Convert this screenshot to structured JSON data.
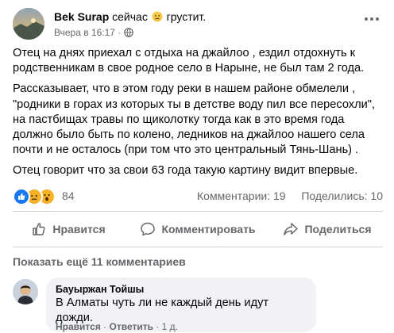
{
  "post": {
    "author": "Bek Surap",
    "activity_prefix": "сейчас",
    "activity_feeling": "грустит.",
    "feeling_emoji": "sad-face-emoji",
    "timestamp": "Вчера в 16:17",
    "separator": "·",
    "audience_icon": "globe-icon",
    "paragraphs": [
      "Отец на днях приехал с отдыха на джайлоо , ездил отдохнуть к\nродственникам  в свое родное  село в Нарыне, не был там 2 года.",
      "Рассказывает, что в этом году  реки в нашем районе  обмелели ,\n\"родники в горах из которых ты в детстве воду пил все пересохли\",\nна пастбищах травы по щиколотку тогда как в это время года\nдолжно было быть  по колено, ледников на джайлоо нашего села\nпочти и не осталось (при том что это центральный Тянь-Шань) .",
      "Отец говорит что за свои 63 года такую картину  видит впервые."
    ]
  },
  "reactions": {
    "icons": [
      "like-icon",
      "sad-icon",
      "wow-icon"
    ],
    "count": "84",
    "comments": "Комментарии: 19",
    "shares": "Поделились: 10"
  },
  "actions": {
    "like": "Нравится",
    "comment": "Комментировать",
    "share": "Поделиться"
  },
  "comments": {
    "more_label": "Показать ещё 11 комментариев",
    "items": [
      {
        "author": "Бауыржан Тойшы",
        "text": "В Алматы чуть ли не каждый день идут дожди.",
        "like": "Нравится",
        "sep": "·",
        "reply": "Ответить",
        "age": "1 д."
      }
    ]
  },
  "colors": {
    "secondary_text": "#65676b",
    "bubble": "#f0f2f5",
    "like_blue": "#1877f2",
    "sad_yellow": "#f7b125"
  }
}
